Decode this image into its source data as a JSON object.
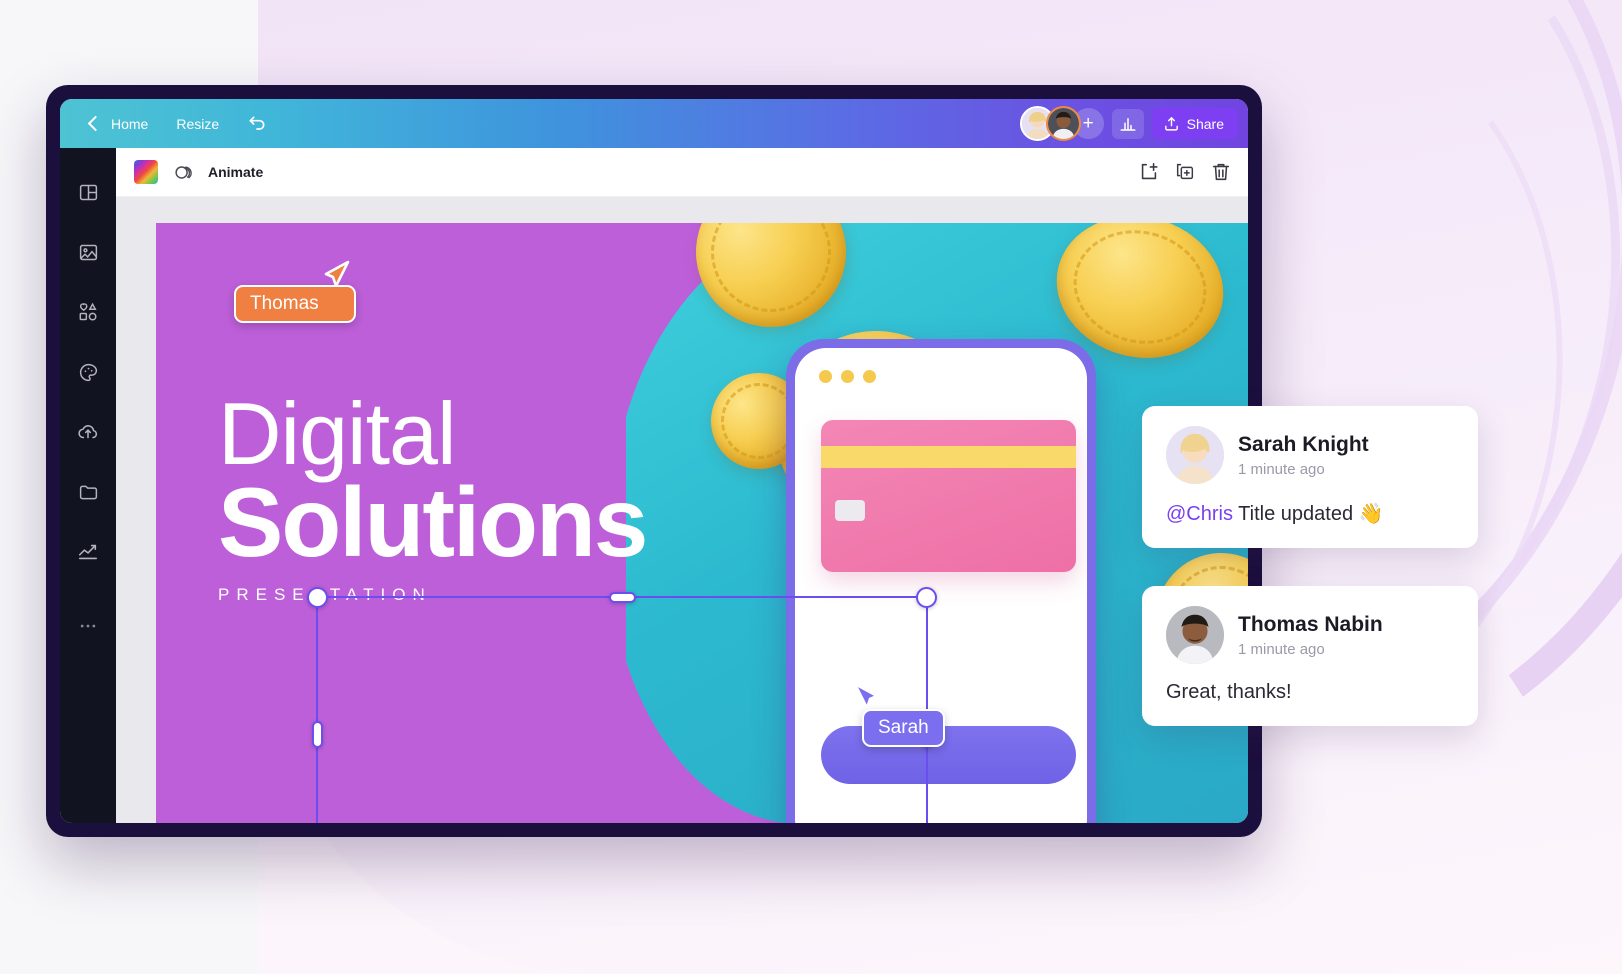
{
  "appbar": {
    "back_icon": "chevron-left-icon",
    "home_label": "Home",
    "resize_label": "Resize",
    "undo_icon": "undo-icon",
    "add_collaborator_icon": "plus-icon",
    "analytics_icon": "bar-chart-icon",
    "share_icon": "upload-icon",
    "share_label": "Share",
    "collaborators": [
      {
        "name": "Sarah Knight",
        "ring_color": "#ffffff"
      },
      {
        "name": "Thomas Nabin",
        "ring_color": "#f08a3c"
      }
    ]
  },
  "sidebar": {
    "items": [
      {
        "icon": "templates-icon",
        "name": "templates"
      },
      {
        "icon": "photos-icon",
        "name": "photos"
      },
      {
        "icon": "elements-icon",
        "name": "elements"
      },
      {
        "icon": "styles-palette-icon",
        "name": "styles"
      },
      {
        "icon": "uploads-cloud-icon",
        "name": "uploads"
      },
      {
        "icon": "projects-folder-icon",
        "name": "projects"
      },
      {
        "icon": "charts-trend-icon",
        "name": "charts"
      },
      {
        "icon": "more-dots-icon",
        "name": "more"
      }
    ]
  },
  "toolbar": {
    "color_swatch_name": "color-swatch",
    "transparency_icon": "transparency-icon",
    "animate_label": "Animate",
    "add_page_icon": "add-page-icon",
    "duplicate_icon": "duplicate-page-icon",
    "delete_icon": "trash-icon"
  },
  "slide": {
    "title_line1": "Digital",
    "title_line2": "Solutions",
    "subtitle": "PRESENTATION",
    "colors": {
      "purple": "#bd5fd9",
      "teal": "#2cb9cf",
      "coin_gold": "#f0c63f",
      "phone_frame": "#7c6ce8",
      "card_pink": "#ef7fae",
      "card_stripe": "#f8d96a",
      "selection": "#6b4ef0"
    }
  },
  "cursors": [
    {
      "label": "Thomas",
      "color": "#ef8042"
    },
    {
      "label": "Sarah",
      "color": "#7b6ff0"
    }
  ],
  "comments": [
    {
      "name": "Sarah Knight",
      "time": "1 minute ago",
      "mention": "@Chris",
      "text": " Title updated 👋"
    },
    {
      "name": "Thomas Nabin",
      "time": "1 minute ago",
      "mention": "",
      "text": "Great, thanks!"
    }
  ]
}
